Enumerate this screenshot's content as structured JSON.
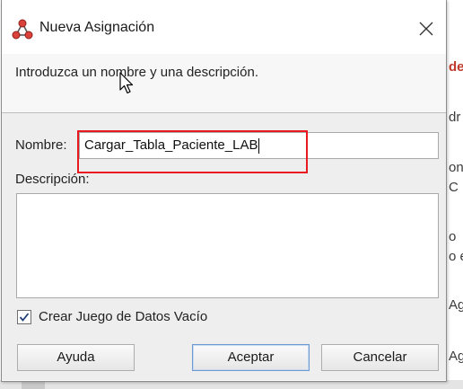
{
  "window": {
    "title": "Nueva Asignación",
    "close_label": "×"
  },
  "header": {
    "instruction": "Introduzca un nombre y una descripción."
  },
  "form": {
    "name_label": "Nombre:",
    "name_value": "Cargar_Tabla_Paciente_LAB",
    "description_label": "Descripción:",
    "description_value": "",
    "checkbox_label": "Crear Juego de Datos Vacío",
    "checkbox_checked": true
  },
  "buttons": {
    "help": "Ayuda",
    "ok": "Aceptar",
    "cancel": "Cancelar"
  },
  "background_fragments": [
    "de",
    "dr",
    "on",
    "C",
    "o",
    "o e",
    "Ag",
    "Ag"
  ],
  "colors": {
    "highlight": "#e8191f",
    "default_button_border": "#6f9ad1"
  }
}
